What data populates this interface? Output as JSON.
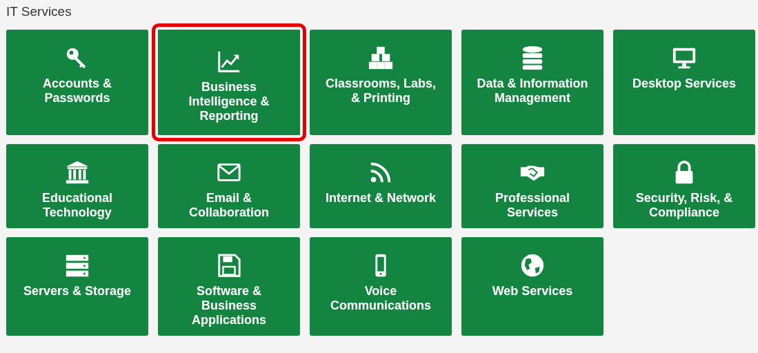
{
  "title": "IT Services",
  "tiles": [
    {
      "label": "Accounts & Passwords",
      "selected": false
    },
    {
      "label": "Business Intelligence & Reporting",
      "selected": true
    },
    {
      "label": "Classrooms, Labs, & Printing",
      "selected": false
    },
    {
      "label": "Data & Information Management",
      "selected": false
    },
    {
      "label": "Desktop Services",
      "selected": false
    },
    {
      "label": "Educational Technology",
      "selected": false
    },
    {
      "label": "Email & Collaboration",
      "selected": false
    },
    {
      "label": "Internet & Network",
      "selected": false
    },
    {
      "label": "Professional Services",
      "selected": false
    },
    {
      "label": "Security, Risk, & Compliance",
      "selected": false
    },
    {
      "label": "Servers & Storage",
      "selected": false
    },
    {
      "label": "Software & Business Applications",
      "selected": false
    },
    {
      "label": "Voice Communications",
      "selected": false
    },
    {
      "label": "Web Services",
      "selected": false
    }
  ]
}
